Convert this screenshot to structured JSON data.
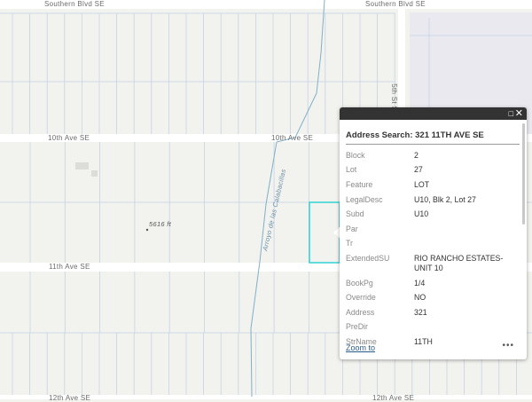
{
  "map": {
    "roads": {
      "southern_left": "Southern Blvd SE",
      "southern_right": "Southern Blvd SE",
      "tenth_left": "10th Ave SE",
      "tenth_right": "10th Ave SE",
      "eleventh": "11th Ave SE",
      "twelfth_left": "12th Ave SE",
      "twelfth_right": "12th Ave SE",
      "fifth_st": "5th St SE"
    },
    "arroyo_label": "Arroyo de las Calabacillas",
    "elevation_label": "5616 ft",
    "colors": {
      "parcel_line": "#c5d3e6",
      "selected_parcel": "#2ed3d3",
      "arroyo": "#7fb0c8",
      "background": "#f2f2ee",
      "landuse": "#ebe9f0"
    }
  },
  "popup": {
    "title": "Address Search: 321 11TH AVE SE",
    "maximize_icon": "maximize-icon",
    "close_icon": "close-icon",
    "fields": [
      {
        "label": "Block",
        "value": "2"
      },
      {
        "label": "Lot",
        "value": "27"
      },
      {
        "label": "Feature",
        "value": "LOT"
      },
      {
        "label": "LegalDesc",
        "value": "U10, Blk 2, Lot 27"
      },
      {
        "label": "Subd",
        "value": "U10"
      },
      {
        "label": "Par",
        "value": ""
      },
      {
        "label": "Tr",
        "value": ""
      },
      {
        "label": "ExtendedSU",
        "value": "RIO RANCHO ESTATES-UNIT 10"
      },
      {
        "label": "BookPg",
        "value": "1/4"
      },
      {
        "label": "Override",
        "value": "NO"
      },
      {
        "label": "Address",
        "value": "321"
      },
      {
        "label": "PreDir",
        "value": ""
      },
      {
        "label": "StrName",
        "value": "11TH"
      }
    ],
    "zoom_to": "Zoom to",
    "more": "•••"
  }
}
